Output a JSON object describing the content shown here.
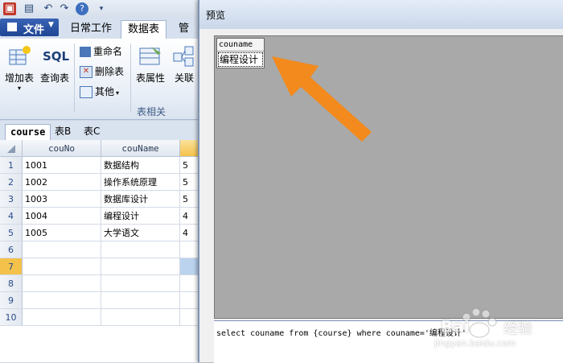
{
  "ribbon": {
    "file_menu": "文件",
    "tabs": [
      "日常工作",
      "数据表",
      "管理"
    ],
    "buttons": {
      "add_table": "增加表",
      "sql_query": "查询表",
      "sql_icon_text": "SQL",
      "rename": "重命名",
      "delete_table": "删除表",
      "other": "其他",
      "table_props": "表属性",
      "relation": "关联"
    },
    "group_label": "表相关"
  },
  "table_tabs": [
    "course",
    "表B",
    "表C"
  ],
  "grid": {
    "columns": [
      "couNo",
      "couName"
    ],
    "rows": [
      {
        "num": "1",
        "couNo": "1001",
        "couName": "数据结构",
        "extra": "5"
      },
      {
        "num": "2",
        "couNo": "1002",
        "couName": "操作系统原理",
        "extra": "5"
      },
      {
        "num": "3",
        "couNo": "1003",
        "couName": "数据库设计",
        "extra": "5"
      },
      {
        "num": "4",
        "couNo": "1004",
        "couName": "编程设计",
        "extra": "4"
      },
      {
        "num": "5",
        "couNo": "1005",
        "couName": "大学语文",
        "extra": "4"
      },
      {
        "num": "6",
        "couNo": "",
        "couName": "",
        "extra": ""
      },
      {
        "num": "7",
        "couNo": "",
        "couName": "",
        "extra": ""
      },
      {
        "num": "8",
        "couNo": "",
        "couName": "",
        "extra": ""
      },
      {
        "num": "9",
        "couNo": "",
        "couName": "",
        "extra": ""
      },
      {
        "num": "10",
        "couNo": "",
        "couName": "",
        "extra": ""
      }
    ]
  },
  "preview": {
    "title": "预览",
    "result_header": "couname",
    "result_value": "编程设计",
    "sql": "select couname from {course} where couname='编程设计'"
  },
  "watermark": {
    "brand": "Bai",
    "cn": "经验",
    "url": "jingyan.baidu.com"
  },
  "colors": {
    "arrow": "#f28a1d",
    "file_menu": "#2a52a8",
    "selected_row": "#bcd3ef"
  }
}
